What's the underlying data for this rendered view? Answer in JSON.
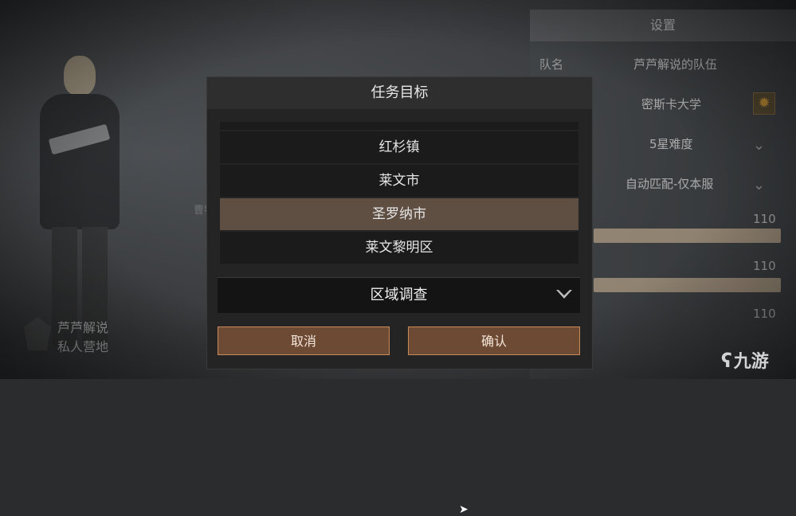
{
  "player": {
    "name": "芦芦解说",
    "camp": "私人营地"
  },
  "side_label": "曹特E",
  "settings": {
    "title": "设置",
    "team_label": "队名",
    "team_name": "芦芦解说的队伍",
    "location": "密斯卡大学",
    "difficulty": "5星难度",
    "matchmaking": "自动匹配-仅本服",
    "slider_values": [
      "110",
      "110",
      "110"
    ]
  },
  "modal": {
    "title": "任务目标",
    "options": [
      "红杉镇",
      "红杉镇",
      "莱文市",
      "圣罗纳市",
      "莱文黎明区"
    ],
    "selected_index": 3,
    "dropdown_value": "区域调查",
    "cancel_label": "取消",
    "confirm_label": "确认"
  },
  "watermark": "九游",
  "icons": {
    "gear": "gear-icon",
    "chevron": "chevron-down-icon",
    "cursor": "mouse-cursor-icon",
    "logo": "jiuyou-logo-icon"
  },
  "colors": {
    "accent_button": "#6d4a34",
    "accent_border": "#c98a5a",
    "selected_row": "#5f4e42",
    "gear": "#e0a030"
  }
}
